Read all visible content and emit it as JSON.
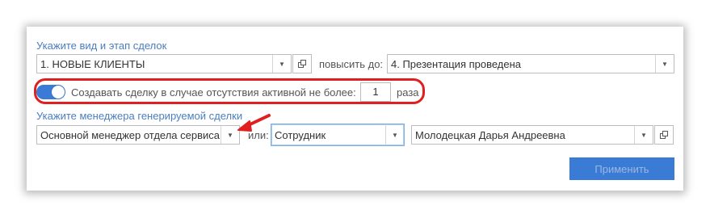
{
  "deal_section": {
    "label": "Укажите вид и этап сделок",
    "deal_type_value": "1. НОВЫЕ КЛИЕНТЫ",
    "raise_label": "повысить до:",
    "stage_value": "4. Презентация проведена"
  },
  "create_deal": {
    "toggle_on": true,
    "text": "Создавать сделку в случае отсутствия активной не более:",
    "count_value": "1",
    "suffix": "раза"
  },
  "manager_section": {
    "label": "Укажите менеджера генерируемой сделки",
    "manager_type_value": "Основной менеджер отдела сервиса",
    "or_label": "или:",
    "role_value": "Сотрудник",
    "person_value": "Молодецкая Дарья Андреевна"
  },
  "apply_button": {
    "label": "Применить"
  },
  "colors": {
    "accent": "#3a7bd5",
    "label_blue": "#4a7ec0",
    "highlight_red": "#e02020"
  }
}
